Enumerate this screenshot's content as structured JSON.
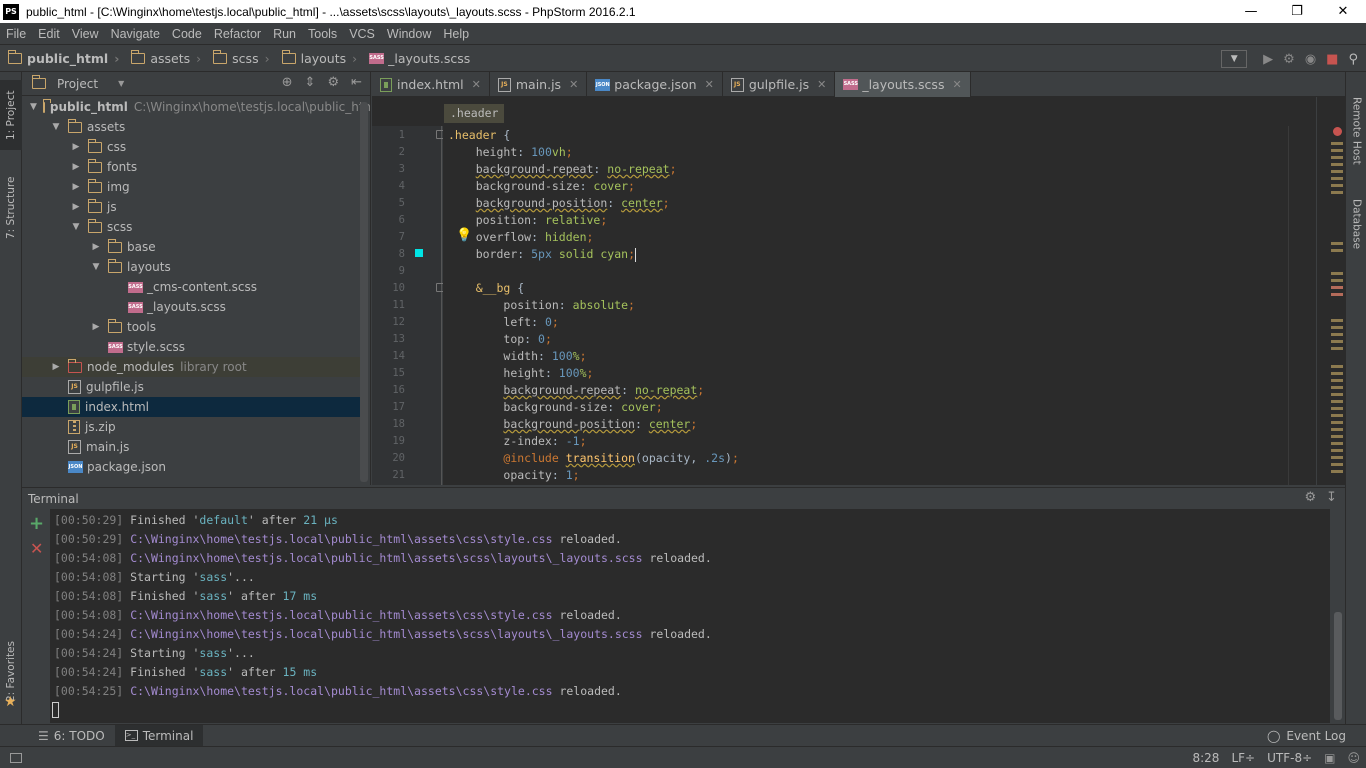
{
  "window": {
    "title": "public_html - [C:\\Winginx\\home\\testjs.local\\public_html] - ...\\assets\\scss\\layouts\\_layouts.scss - PhpStorm 2016.2.1",
    "app_icon": "PS"
  },
  "menu": [
    "File",
    "Edit",
    "View",
    "Navigate",
    "Code",
    "Refactor",
    "Run",
    "Tools",
    "VCS",
    "Window",
    "Help"
  ],
  "breadcrumbs": [
    "public_html",
    "assets",
    "scss",
    "layouts",
    "_layouts.scss"
  ],
  "left_stripe": {
    "project": "1: Project",
    "structure": "7: Structure",
    "favorites": "2: Favorites"
  },
  "right_stripe": {
    "remote_host": "Remote Host",
    "database": "Database"
  },
  "project": {
    "title": "Project",
    "tree": [
      {
        "label": "public_html",
        "extra": "C:\\Winginx\\home\\testjs.local\\public_html",
        "type": "folder",
        "depth": 0,
        "expanded": true,
        "bold": true
      },
      {
        "label": "assets",
        "type": "folder",
        "depth": 1,
        "expanded": true
      },
      {
        "label": "css",
        "type": "folder",
        "depth": 2,
        "expanded": false
      },
      {
        "label": "fonts",
        "type": "folder",
        "depth": 2,
        "expanded": false
      },
      {
        "label": "img",
        "type": "folder",
        "depth": 2,
        "expanded": false
      },
      {
        "label": "js",
        "type": "folder",
        "depth": 2,
        "expanded": false
      },
      {
        "label": "scss",
        "type": "folder",
        "depth": 2,
        "expanded": true
      },
      {
        "label": "base",
        "type": "folder",
        "depth": 3,
        "expanded": false
      },
      {
        "label": "layouts",
        "type": "folder",
        "depth": 3,
        "expanded": true
      },
      {
        "label": "_cms-content.scss",
        "type": "sass",
        "depth": 4
      },
      {
        "label": "_layouts.scss",
        "type": "sass",
        "depth": 4
      },
      {
        "label": "tools",
        "type": "folder",
        "depth": 3,
        "expanded": false
      },
      {
        "label": "style.scss",
        "type": "sass",
        "depth": 3
      },
      {
        "label": "node_modules",
        "extra": "library root",
        "type": "folder-lib",
        "depth": 1,
        "expanded": false
      },
      {
        "label": "gulpfile.js",
        "type": "js",
        "depth": 1
      },
      {
        "label": "index.html",
        "type": "html",
        "depth": 1,
        "selected": true
      },
      {
        "label": "js.zip",
        "type": "zip",
        "depth": 1
      },
      {
        "label": "main.js",
        "type": "js",
        "depth": 1
      },
      {
        "label": "package.json",
        "type": "json",
        "depth": 1
      }
    ]
  },
  "editor": {
    "tabs": [
      {
        "label": "index.html",
        "type": "html"
      },
      {
        "label": "main.js",
        "type": "js"
      },
      {
        "label": "package.json",
        "type": "json"
      },
      {
        "label": "gulpfile.js",
        "type": "js"
      },
      {
        "label": "_layouts.scss",
        "type": "sass",
        "active": true
      }
    ],
    "breadcrumb": ".header",
    "lines": [
      [
        [
          "sel",
          ".header"
        ],
        [
          "",
          " {"
        ]
      ],
      [
        [
          "",
          "    "
        ],
        [
          "prop",
          "height"
        ],
        [
          "",
          ": "
        ],
        [
          "num",
          "100"
        ],
        [
          "val",
          "vh"
        ],
        [
          "punct",
          ";"
        ]
      ],
      [
        [
          "",
          "    "
        ],
        [
          "prop err-ul",
          "background-repeat"
        ],
        [
          "",
          ": "
        ],
        [
          "val err-ul",
          "no-repeat"
        ],
        [
          "punct",
          ";"
        ]
      ],
      [
        [
          "",
          "    "
        ],
        [
          "prop",
          "background-size"
        ],
        [
          "",
          ": "
        ],
        [
          "val",
          "cover"
        ],
        [
          "punct",
          ";"
        ]
      ],
      [
        [
          "",
          "    "
        ],
        [
          "prop err-ul",
          "background-position"
        ],
        [
          "",
          ": "
        ],
        [
          "val err-ul",
          "center"
        ],
        [
          "punct",
          ";"
        ]
      ],
      [
        [
          "",
          "    "
        ],
        [
          "prop",
          "position"
        ],
        [
          "",
          ": "
        ],
        [
          "val",
          "relative"
        ],
        [
          "punct",
          ";"
        ]
      ],
      [
        [
          "",
          "    "
        ],
        [
          "prop",
          "overflow"
        ],
        [
          "",
          ": "
        ],
        [
          "val",
          "hidden"
        ],
        [
          "punct",
          ";"
        ]
      ],
      [
        [
          "",
          "    "
        ],
        [
          "prop",
          "border"
        ],
        [
          "",
          ": "
        ],
        [
          "num",
          "5px"
        ],
        [
          "",
          " "
        ],
        [
          "val",
          "solid cyan"
        ],
        [
          "punct",
          ";"
        ]
      ],
      [
        [
          "",
          ""
        ]
      ],
      [
        [
          "",
          "    "
        ],
        [
          "sel",
          "&__bg"
        ],
        [
          "",
          " {"
        ]
      ],
      [
        [
          "",
          "        "
        ],
        [
          "prop",
          "position"
        ],
        [
          "",
          ": "
        ],
        [
          "val",
          "absolute"
        ],
        [
          "punct",
          ";"
        ]
      ],
      [
        [
          "",
          "        "
        ],
        [
          "prop",
          "left"
        ],
        [
          "",
          ": "
        ],
        [
          "num",
          "0"
        ],
        [
          "punct",
          ";"
        ]
      ],
      [
        [
          "",
          "        "
        ],
        [
          "prop",
          "top"
        ],
        [
          "",
          ": "
        ],
        [
          "num",
          "0"
        ],
        [
          "punct",
          ";"
        ]
      ],
      [
        [
          "",
          "        "
        ],
        [
          "prop",
          "width"
        ],
        [
          "",
          ": "
        ],
        [
          "num",
          "100"
        ],
        [
          "val",
          "%"
        ],
        [
          "punct",
          ";"
        ]
      ],
      [
        [
          "",
          "        "
        ],
        [
          "prop",
          "height"
        ],
        [
          "",
          ": "
        ],
        [
          "num",
          "100"
        ],
        [
          "val",
          "%"
        ],
        [
          "punct",
          ";"
        ]
      ],
      [
        [
          "",
          "        "
        ],
        [
          "prop err-ul",
          "background-repeat"
        ],
        [
          "",
          ": "
        ],
        [
          "val err-ul",
          "no-repeat"
        ],
        [
          "punct",
          ";"
        ]
      ],
      [
        [
          "",
          "        "
        ],
        [
          "prop",
          "background-size"
        ],
        [
          "",
          ": "
        ],
        [
          "val",
          "cover"
        ],
        [
          "punct",
          ";"
        ]
      ],
      [
        [
          "",
          "        "
        ],
        [
          "prop err-ul",
          "background-position"
        ],
        [
          "",
          ": "
        ],
        [
          "val err-ul",
          "center"
        ],
        [
          "punct",
          ";"
        ]
      ],
      [
        [
          "",
          "        "
        ],
        [
          "prop",
          "z-index"
        ],
        [
          "",
          ": "
        ],
        [
          "num",
          "-1"
        ],
        [
          "punct",
          ";"
        ]
      ],
      [
        [
          "",
          "        "
        ],
        [
          "kw",
          "@include"
        ],
        [
          "",
          " "
        ],
        [
          "fn err-ul",
          "transition"
        ],
        [
          "",
          "(opacity, "
        ],
        [
          "num",
          ".2s"
        ],
        [
          "",
          ")"
        ],
        [
          "punct",
          ";"
        ]
      ],
      [
        [
          "",
          "        "
        ],
        [
          "prop",
          "opacity"
        ],
        [
          "",
          ": "
        ],
        [
          "num",
          "1"
        ],
        [
          "punct",
          ";"
        ]
      ]
    ]
  },
  "terminal": {
    "title": "Terminal",
    "lines": [
      [
        [
          "ts",
          "[00:50:29]"
        ],
        [
          "",
          " Finished '"
        ],
        [
          "tstr",
          "default"
        ],
        [
          "",
          "' after "
        ],
        [
          "tstr",
          "21 μs"
        ]
      ],
      [
        [
          "ts",
          "[00:50:29]"
        ],
        [
          "",
          " "
        ],
        [
          "path",
          "C:\\Winginx\\home\\testjs.local\\public_html\\assets\\css\\style.css"
        ],
        [
          "",
          " reloaded."
        ]
      ],
      [
        [
          "ts",
          "[00:54:08]"
        ],
        [
          "",
          " "
        ],
        [
          "path",
          "C:\\Winginx\\home\\testjs.local\\public_html\\assets\\scss\\layouts\\_layouts.scss"
        ],
        [
          "",
          " reloaded."
        ]
      ],
      [
        [
          "ts",
          "[00:54:08]"
        ],
        [
          "",
          " Starting '"
        ],
        [
          "tstr",
          "sass"
        ],
        [
          "",
          "'..."
        ]
      ],
      [
        [
          "ts",
          "[00:54:08]"
        ],
        [
          "",
          " Finished '"
        ],
        [
          "tstr",
          "sass"
        ],
        [
          "",
          "' after "
        ],
        [
          "tstr",
          "17 ms"
        ]
      ],
      [
        [
          "ts",
          "[00:54:08]"
        ],
        [
          "",
          " "
        ],
        [
          "path",
          "C:\\Winginx\\home\\testjs.local\\public_html\\assets\\css\\style.css"
        ],
        [
          "",
          " reloaded."
        ]
      ],
      [
        [
          "ts",
          "[00:54:24]"
        ],
        [
          "",
          " "
        ],
        [
          "path",
          "C:\\Winginx\\home\\testjs.local\\public_html\\assets\\scss\\layouts\\_layouts.scss"
        ],
        [
          "",
          " reloaded."
        ]
      ],
      [
        [
          "ts",
          "[00:54:24]"
        ],
        [
          "",
          " Starting '"
        ],
        [
          "tstr",
          "sass"
        ],
        [
          "",
          "'..."
        ]
      ],
      [
        [
          "ts",
          "[00:54:24]"
        ],
        [
          "",
          " Finished '"
        ],
        [
          "tstr",
          "sass"
        ],
        [
          "",
          "' after "
        ],
        [
          "tstr",
          "15 ms"
        ]
      ],
      [
        [
          "ts",
          "[00:54:25]"
        ],
        [
          "",
          " "
        ],
        [
          "path",
          "C:\\Winginx\\home\\testjs.local\\public_html\\assets\\css\\style.css"
        ],
        [
          "",
          " reloaded."
        ]
      ]
    ]
  },
  "bottom_tabs": {
    "todo": "6: TODO",
    "terminal": "Terminal",
    "event_log": "Event Log"
  },
  "status": {
    "position": "8:28",
    "line_sep": "LF÷",
    "encoding": "UTF-8÷"
  },
  "colors": {
    "accent_cyan": "#00e5e5",
    "selection": "#0d293e"
  }
}
